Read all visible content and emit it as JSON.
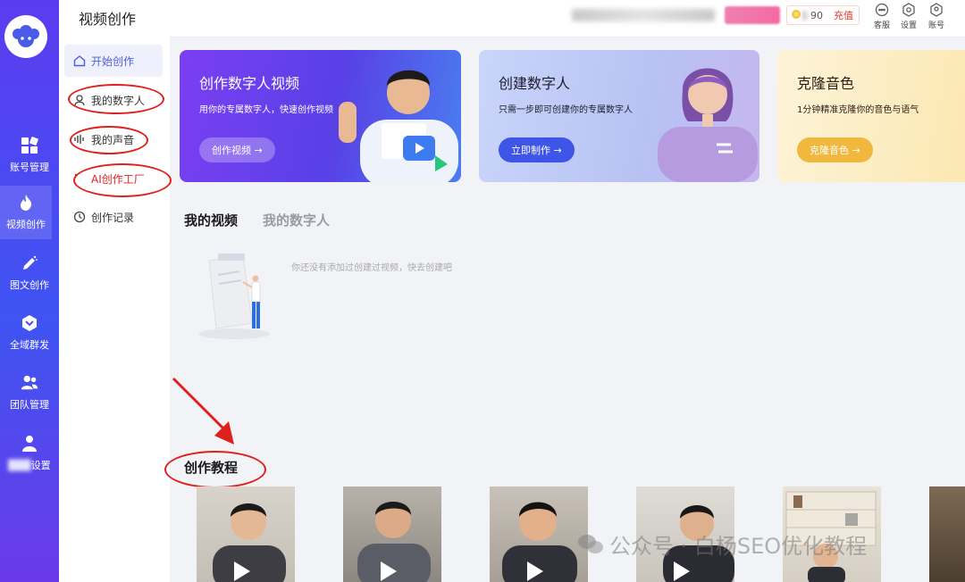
{
  "page_title": "视频创作",
  "rail": {
    "items": [
      {
        "label": "账号管理",
        "icon": "grid-icon"
      },
      {
        "label": "视频创作",
        "icon": "flame-icon",
        "active": true
      },
      {
        "label": "图文创作",
        "icon": "pen-icon"
      },
      {
        "label": "全域群发",
        "icon": "cube-icon"
      },
      {
        "label": "团队管理",
        "icon": "team-icon"
      },
      {
        "label": "设置",
        "icon": "person-icon"
      }
    ]
  },
  "subnav": {
    "items": [
      {
        "label": "开始创作",
        "icon": "home-icon",
        "active": true
      },
      {
        "label": "我的数字人",
        "icon": "avatar-icon"
      },
      {
        "label": "我的声音",
        "icon": "sound-icon"
      },
      {
        "label": "AI创作工厂",
        "icon": "factory-icon"
      },
      {
        "label": "创作记录",
        "icon": "clock-icon"
      }
    ]
  },
  "topbar": {
    "coin_value": "90",
    "recharge": "充值",
    "icons": [
      {
        "label": "客服",
        "icon": "chat-icon"
      },
      {
        "label": "设置",
        "icon": "gear-icon"
      },
      {
        "label": "账号",
        "icon": "account-icon"
      }
    ]
  },
  "cards": [
    {
      "title": "创作数字人视频",
      "subtitle": "用你的专属数字人，快速创作视频",
      "button": "创作视频 →"
    },
    {
      "title": "创建数字人",
      "subtitle": "只需一步即可创建你的专属数字人",
      "button": "立即制作 →"
    },
    {
      "title": "克隆音色",
      "subtitle": "1分钟精准克隆你的音色与语气",
      "button": "克隆音色 →"
    }
  ],
  "tabs": [
    {
      "label": "我的视频",
      "active": true
    },
    {
      "label": "我的数字人",
      "active": false
    }
  ],
  "empty_text": "你还没有添加过创建过视频，快去创建吧",
  "tutorial_title": "创作教程",
  "watermark": "公众号 · 白杨SEO优化教程",
  "colors": {
    "accent": "#4c5ee6",
    "rail_top": "#5b3cf0",
    "annotation": "#e0201c",
    "recharge": "#e03b2c"
  }
}
